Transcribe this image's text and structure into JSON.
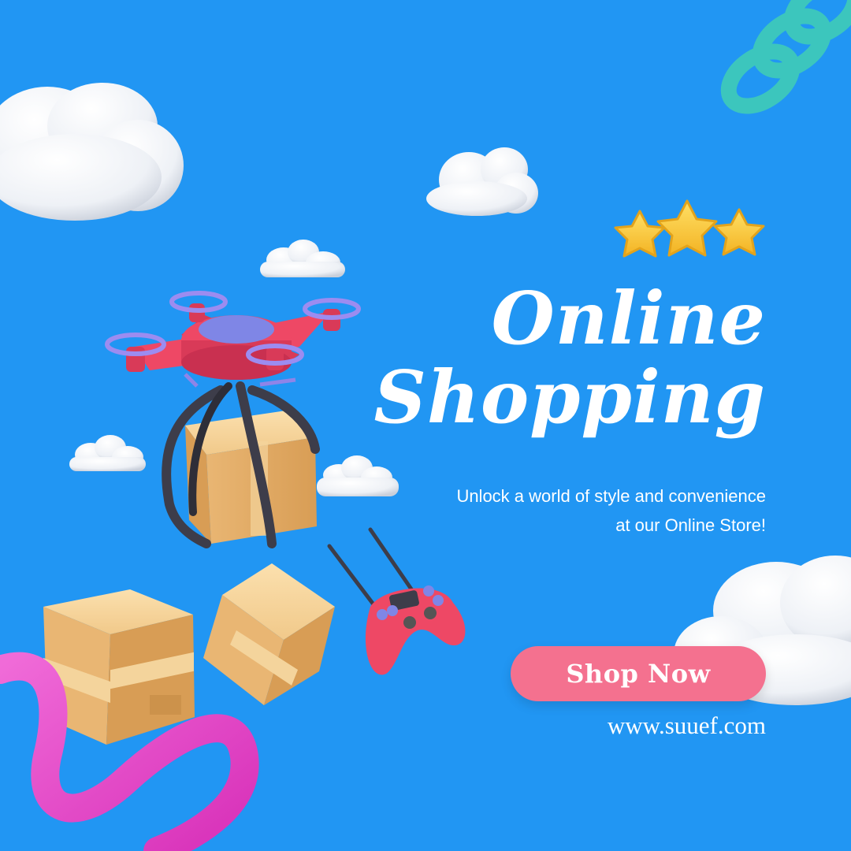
{
  "headline": {
    "line1": "Online",
    "line2": "Shopping"
  },
  "tagline": {
    "line1": "Unlock a world of style and convenience",
    "line2": "at our Online Store!"
  },
  "cta": {
    "label": "Shop Now"
  },
  "website": {
    "url": "www.suuef.com"
  },
  "rating": {
    "stars": 3
  },
  "colors": {
    "background": "#2196f3",
    "button": "#f4718f",
    "text": "#ffffff",
    "drone": "#ee4865",
    "box": "#e9b673",
    "ribbon": "#e63fc8",
    "spring": "#3cc6bd",
    "star": "#f8c733"
  },
  "icons": [
    "cloud-icon",
    "star-icon",
    "drone-icon",
    "package-box-icon",
    "game-controller-icon",
    "spring-coil-icon",
    "ribbon-tube-icon"
  ]
}
